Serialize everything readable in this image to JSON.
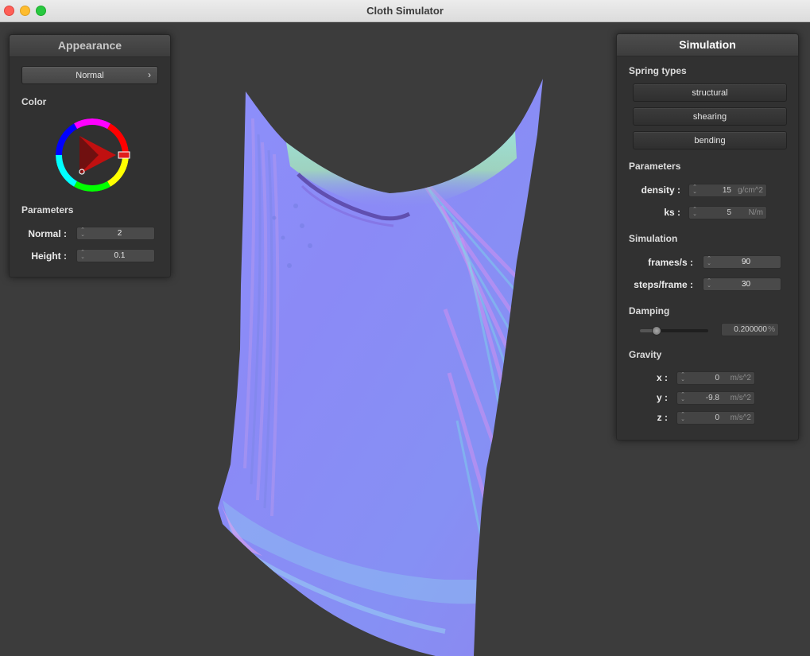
{
  "window": {
    "title": "Cloth Simulator"
  },
  "appearance": {
    "header": "Appearance",
    "shader_select": {
      "value": "Normal",
      "chevron": "›"
    },
    "color_label": "Color",
    "parameters_label": "Parameters",
    "normal": {
      "label": "Normal :",
      "value": "2"
    },
    "height": {
      "label": "Height :",
      "value": "0.1"
    }
  },
  "simulation": {
    "header": "Simulation",
    "spring_types_label": "Spring types",
    "spring_buttons": [
      "structural",
      "shearing",
      "bending"
    ],
    "parameters_label": "Parameters",
    "density": {
      "label": "density :",
      "value": "15",
      "unit": "g/cm^2"
    },
    "ks": {
      "label": "ks :",
      "value": "5",
      "unit": "N/m"
    },
    "simulation_label": "Simulation",
    "frames_per_s": {
      "label": "frames/s :",
      "value": "90"
    },
    "steps_per_frame": {
      "label": "steps/frame :",
      "value": "30"
    },
    "damping_label": "Damping",
    "damping": {
      "value": "0.200000",
      "unit": "%",
      "slider_fraction": 0.2
    },
    "gravity_label": "Gravity",
    "gravity": {
      "x": {
        "label": "x :",
        "value": "0",
        "unit": "m/s^2"
      },
      "y": {
        "label": "y :",
        "value": "-9.8",
        "unit": "m/s^2"
      },
      "z": {
        "label": "z :",
        "value": "0",
        "unit": "m/s^2"
      }
    }
  },
  "colors": {
    "viewport_bg": "#3c3c3c",
    "cloth_base": "#8a8cf8",
    "color_wheel_selected": "#e01c1c"
  }
}
